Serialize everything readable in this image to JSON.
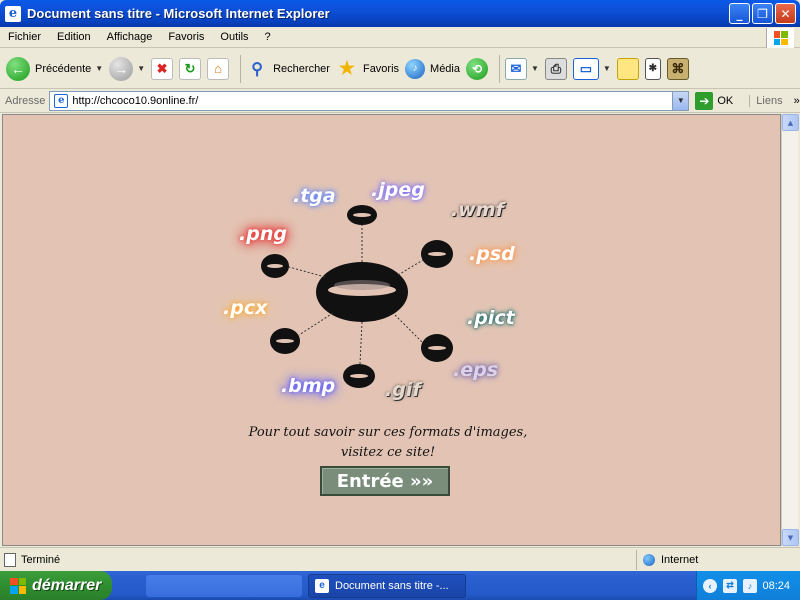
{
  "window": {
    "title": "Document sans titre - Microsoft Internet Explorer",
    "app_icon": "ie-icon",
    "controls": [
      "minimize-icon",
      "maximize-icon",
      "close-icon"
    ]
  },
  "menubar": {
    "items": [
      "Fichier",
      "Edition",
      "Affichage",
      "Favoris",
      "Outils",
      "?"
    ]
  },
  "toolbar": {
    "back_label": "Précédente",
    "search_label": "Rechercher",
    "favorites_label": "Favoris",
    "media_label": "Média"
  },
  "address": {
    "label": "Adresse",
    "url": "http://chcoco10.9online.fr/",
    "go_label": "OK",
    "links_label": "Liens"
  },
  "content": {
    "background": "#e3c4b4",
    "formats": [
      ".tga",
      ".jpeg",
      ".wmf",
      ".png",
      ".psd",
      ".pcx",
      ".pict",
      ".eps",
      ".bmp",
      ".gif"
    ],
    "caption_line1": "Pour tout savoir sur ces formats d'images,",
    "caption_line2": "visitez ce site!",
    "enter_button": "Entrée »»"
  },
  "statusbar": {
    "status": "Terminé",
    "zone": "Internet"
  },
  "taskbar": {
    "start_label": "démarrer",
    "task_label": "Document sans titre -...",
    "clock": "08:24"
  }
}
